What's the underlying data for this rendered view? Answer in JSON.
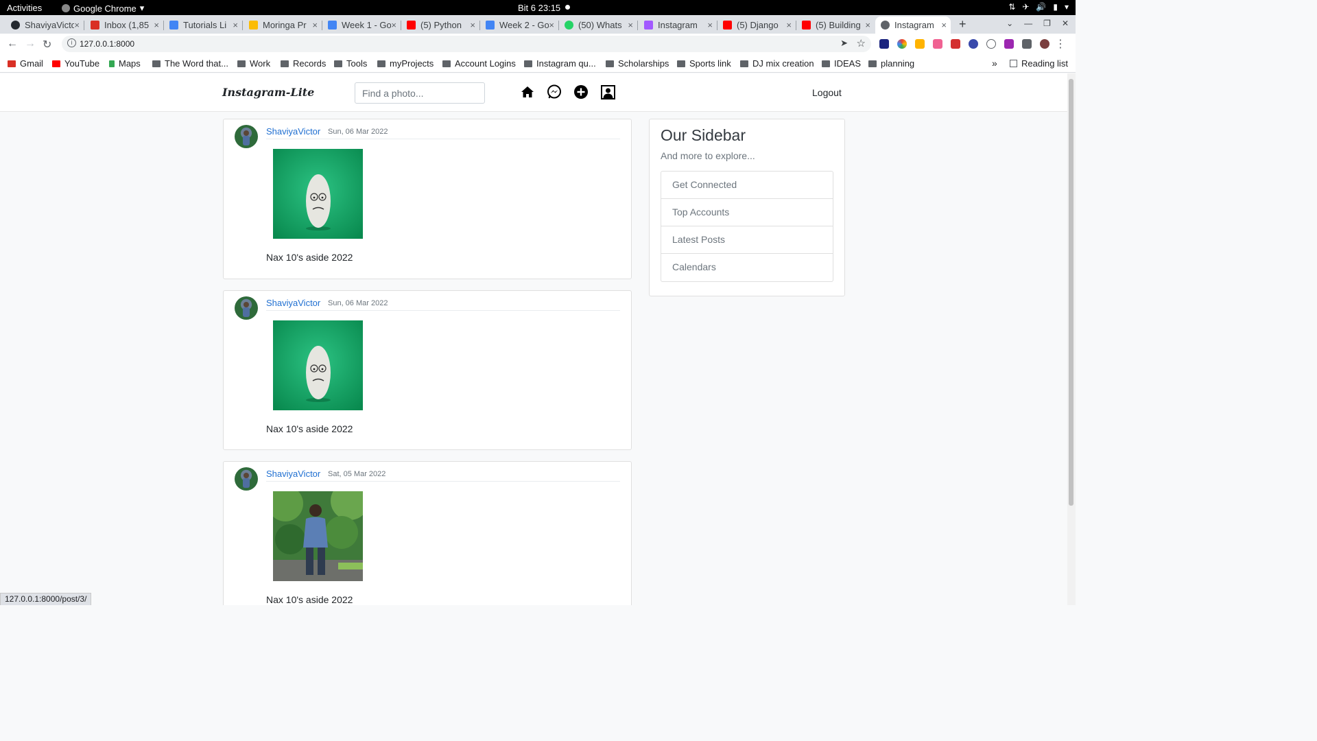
{
  "system": {
    "activities": "Activities",
    "app_name": "Google Chrome",
    "clock": "Bit 6  23:15"
  },
  "tabs": [
    {
      "label": "ShaviyaVictor",
      "color": "#24292f"
    },
    {
      "label": "Inbox (1,85",
      "color": "#d93025"
    },
    {
      "label": "Tutorials Li",
      "color": "#4285f4"
    },
    {
      "label": "Moringa Pr",
      "color": "#fbbc04"
    },
    {
      "label": "Week 1 - Go",
      "color": "#4285f4"
    },
    {
      "label": "(5) Python",
      "color": "#ff0000"
    },
    {
      "label": "Week 2 - Go",
      "color": "#4285f4"
    },
    {
      "label": "(50) Whats",
      "color": "#25d366"
    },
    {
      "label": "Instagram",
      "color": "#a259ff"
    },
    {
      "label": "(5) Django",
      "color": "#ff0000"
    },
    {
      "label": "(5) Building",
      "color": "#ff0000"
    },
    {
      "label": "Instagram",
      "color": "#5f6368",
      "active": true
    }
  ],
  "address": {
    "url": "127.0.0.1:8000"
  },
  "bookmarks": [
    {
      "label": "Gmail",
      "color": "#d93025"
    },
    {
      "label": "YouTube",
      "color": "#ff0000"
    },
    {
      "label": "Maps",
      "color": "#34a853"
    },
    {
      "label": "The Word that..."
    },
    {
      "label": "Work"
    },
    {
      "label": "Records"
    },
    {
      "label": "Tools"
    },
    {
      "label": "myProjects"
    },
    {
      "label": "Account Logins"
    },
    {
      "label": "Instagram qu..."
    },
    {
      "label": "Scholarships"
    },
    {
      "label": "Sports link"
    },
    {
      "label": "DJ mix creation"
    },
    {
      "label": "IDEAS"
    },
    {
      "label": "planning"
    }
  ],
  "reading_list": "Reading list",
  "app": {
    "brand": "Instagram-Lite",
    "search_placeholder": "Find a photo...",
    "nav_icons": [
      "home-icon",
      "messenger-icon",
      "add-post-icon",
      "profile-icon"
    ],
    "logout": "Logout"
  },
  "posts": [
    {
      "user": "ShaviyaVictor",
      "date": "Sun, 06 Mar 2022",
      "caption": "Nax 10's aside 2022",
      "image": "egg-photo"
    },
    {
      "user": "ShaviyaVictor",
      "date": "Sun, 06 Mar 2022",
      "caption": "Nax 10's aside 2022",
      "image": "egg-photo"
    },
    {
      "user": "ShaviyaVictor",
      "date": "Sat, 05 Mar 2022",
      "caption": "Nax 10's aside 2022",
      "image": "person-photo"
    }
  ],
  "sidebar": {
    "title": "Our Sidebar",
    "subtitle": "And more to explore...",
    "items": [
      "Get Connected",
      "Top Accounts",
      "Latest Posts",
      "Calendars"
    ]
  },
  "status_url": "127.0.0.1:8000/post/3/",
  "colors": {
    "link": "#1f6fd1",
    "egg_background": "#0fa060"
  }
}
